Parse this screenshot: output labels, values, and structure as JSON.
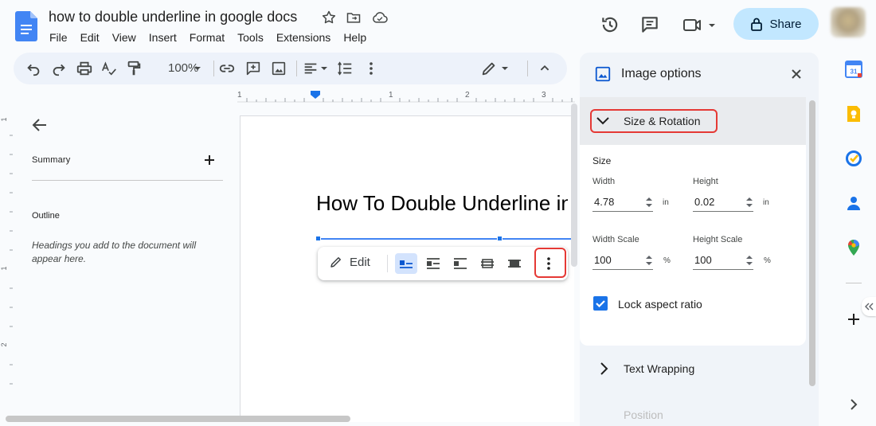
{
  "header": {
    "doc_title": "how to double underline in google docs",
    "menu": [
      "File",
      "Edit",
      "View",
      "Insert",
      "Format",
      "Tools",
      "Extensions",
      "Help"
    ],
    "share_label": "Share",
    "icons": [
      "star-icon",
      "move-to-folder-icon",
      "cloud-saved-icon",
      "history-icon",
      "comments-icon",
      "meet-icon"
    ]
  },
  "toolbar": {
    "zoom": "100%"
  },
  "ruler": {
    "ticks": [
      "1",
      "1",
      "2",
      "3"
    ]
  },
  "vruler": {
    "ticks": [
      "1",
      "1",
      "2"
    ]
  },
  "outline_pane": {
    "summary_label": "Summary",
    "outline_label": "Outline",
    "hint": "Headings you add to the document will appear here."
  },
  "document": {
    "heading": "How To Double Underline in Google Docs"
  },
  "image_toolbar": {
    "edit_label": "Edit"
  },
  "image_options": {
    "title": "Image options",
    "section_title": "Size & Rotation",
    "size_label": "Size",
    "width_label": "Width",
    "width_value": "4.78",
    "width_unit": "in",
    "height_label": "Height",
    "height_value": "0.02",
    "height_unit": "in",
    "width_scale_label": "Width Scale",
    "width_scale_value": "100",
    "width_scale_unit": "%",
    "height_scale_label": "Height Scale",
    "height_scale_value": "100",
    "height_scale_unit": "%",
    "lock_label": "Lock aspect ratio",
    "lock_checked": true,
    "text_wrapping_title": "Text Wrapping",
    "position_title": "Position"
  },
  "side_bar": {
    "apps": [
      "calendar-app-icon",
      "keep-app-icon",
      "tasks-app-icon",
      "contacts-app-icon",
      "maps-app-icon"
    ],
    "calendar_day": "31"
  },
  "colors": {
    "accent": "#1a73e8",
    "share_bg": "#c2e7ff",
    "highlight": "#e53935"
  }
}
